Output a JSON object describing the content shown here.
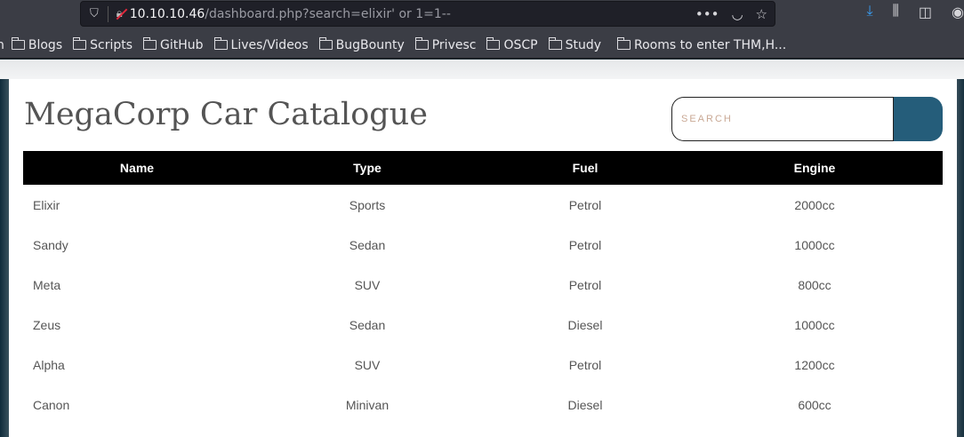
{
  "browser": {
    "url_host": "10.10.10.46",
    "url_path": "/dashboard.php?search=elixir' or 1=1--",
    "bookmarks": [
      "Blogs",
      "Scripts",
      "GitHub",
      "Lives/Videos",
      "BugBounty",
      "Privesc",
      "OSCP",
      "Study",
      "Rooms to enter THM,H..."
    ]
  },
  "page": {
    "title": "MegaCorp Car Catalogue",
    "search_placeholder": "SEARCH",
    "columns": [
      "Name",
      "Type",
      "Fuel",
      "Engine"
    ],
    "rows": [
      [
        "Elixir",
        "Sports",
        "Petrol",
        "2000cc"
      ],
      [
        "Sandy",
        "Sedan",
        "Petrol",
        "1000cc"
      ],
      [
        "Meta",
        "SUV",
        "Petrol",
        "800cc"
      ],
      [
        "Zeus",
        "Sedan",
        "Diesel",
        "1000cc"
      ],
      [
        "Alpha",
        "SUV",
        "Petrol",
        "1200cc"
      ],
      [
        "Canon",
        "Minivan",
        "Diesel",
        "600cc"
      ]
    ]
  }
}
